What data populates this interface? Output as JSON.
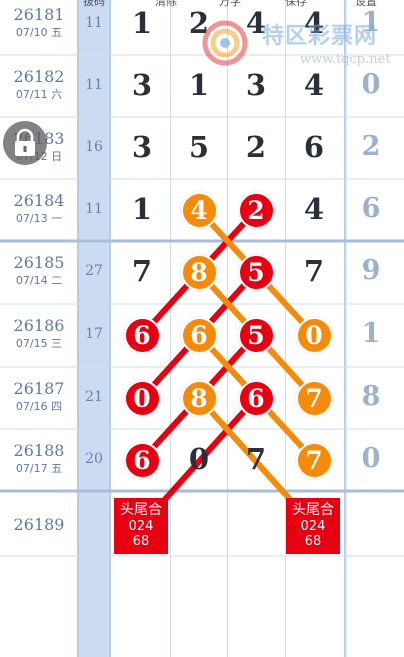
{
  "header": {
    "columns": [
      "拔码",
      "清除",
      "万学",
      "保存",
      "设置"
    ]
  },
  "watermark": {
    "site_name": "特区彩票网",
    "url": "www.tqcp.net"
  },
  "rows": [
    {
      "issue": "26181",
      "date": "07/10 五",
      "sum": "11",
      "d": [
        "1",
        "2",
        "4",
        "4"
      ],
      "last": "1"
    },
    {
      "issue": "26182",
      "date": "07/11 六",
      "sum": "11",
      "d": [
        "3",
        "1",
        "3",
        "4"
      ],
      "last": "0"
    },
    {
      "issue": "26183",
      "date": "07/12 日",
      "sum": "16",
      "d": [
        "3",
        "5",
        "2",
        "6"
      ],
      "last": "2"
    },
    {
      "issue": "26184",
      "date": "07/13 一",
      "sum": "11",
      "d": [
        "1",
        "4",
        "2",
        "4"
      ],
      "last": "6"
    },
    {
      "issue": "26185",
      "date": "07/14 二",
      "sum": "27",
      "d": [
        "7",
        "8",
        "5",
        "7"
      ],
      "last": "9"
    },
    {
      "issue": "26186",
      "date": "07/15 三",
      "sum": "17",
      "d": [
        "6",
        "6",
        "5",
        "0"
      ],
      "last": "1"
    },
    {
      "issue": "26187",
      "date": "07/16 四",
      "sum": "21",
      "d": [
        "0",
        "8",
        "6",
        "7"
      ],
      "last": "8"
    },
    {
      "issue": "26188",
      "date": "07/17 五",
      "sum": "20",
      "d": [
        "6",
        "0",
        "7",
        "7"
      ],
      "last": "0"
    }
  ],
  "future_row": {
    "issue": "26189"
  },
  "predictions": [
    {
      "label": "头尾合",
      "line1": "024",
      "line2": "68"
    },
    {
      "label": "头尾合",
      "line1": "024",
      "line2": "68"
    }
  ],
  "colors": {
    "red": "#e60012",
    "orange": "#f58a0b",
    "sum_bg": "#cbdcf2",
    "grid": "#c7d4e8"
  },
  "icons": {
    "lock": "lock-icon",
    "logo": "lottery-logo-icon"
  }
}
